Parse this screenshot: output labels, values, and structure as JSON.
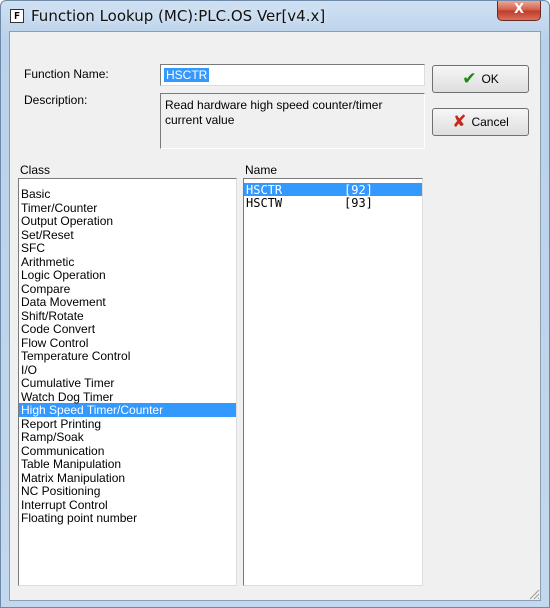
{
  "window": {
    "icon_letter": "F",
    "title": "Function Lookup (MC):PLC.OS Ver[v4.x]",
    "close_glyph": "X"
  },
  "form": {
    "function_name_label": "Function Name:",
    "function_name_value": "HSCTR",
    "description_label": "Description:",
    "description_value": "Read hardware high speed counter/timer current value"
  },
  "buttons": {
    "ok_label": "OK",
    "cancel_label": "Cancel"
  },
  "class_list": {
    "header": "Class",
    "selected": "High Speed Timer/Counter",
    "items": [
      "Basic",
      "Timer/Counter",
      "Output Operation",
      "Set/Reset",
      "SFC",
      "Arithmetic",
      "Logic Operation",
      "Compare",
      "Data Movement",
      "Shift/Rotate",
      "Code Convert",
      "Flow Control",
      "Temperature Control",
      "I/O",
      "Cumulative Timer",
      "Watch Dog Timer",
      "High Speed Timer/Counter",
      "Report Printing",
      "Ramp/Soak",
      "Communication",
      "Table Manipulation",
      "Matrix Manipulation",
      "NC Positioning",
      "Interrupt Control",
      "Floating point number"
    ]
  },
  "name_list": {
    "header": "Name",
    "items": [
      {
        "name": "HSCTR",
        "code": "[92]",
        "selected": true
      },
      {
        "name": "HSCTW",
        "code": "[93]",
        "selected": false
      }
    ]
  },
  "colors": {
    "selection": "#3399ff",
    "ok_check": "#1a8a14",
    "cancel_x": "#c9281c"
  }
}
